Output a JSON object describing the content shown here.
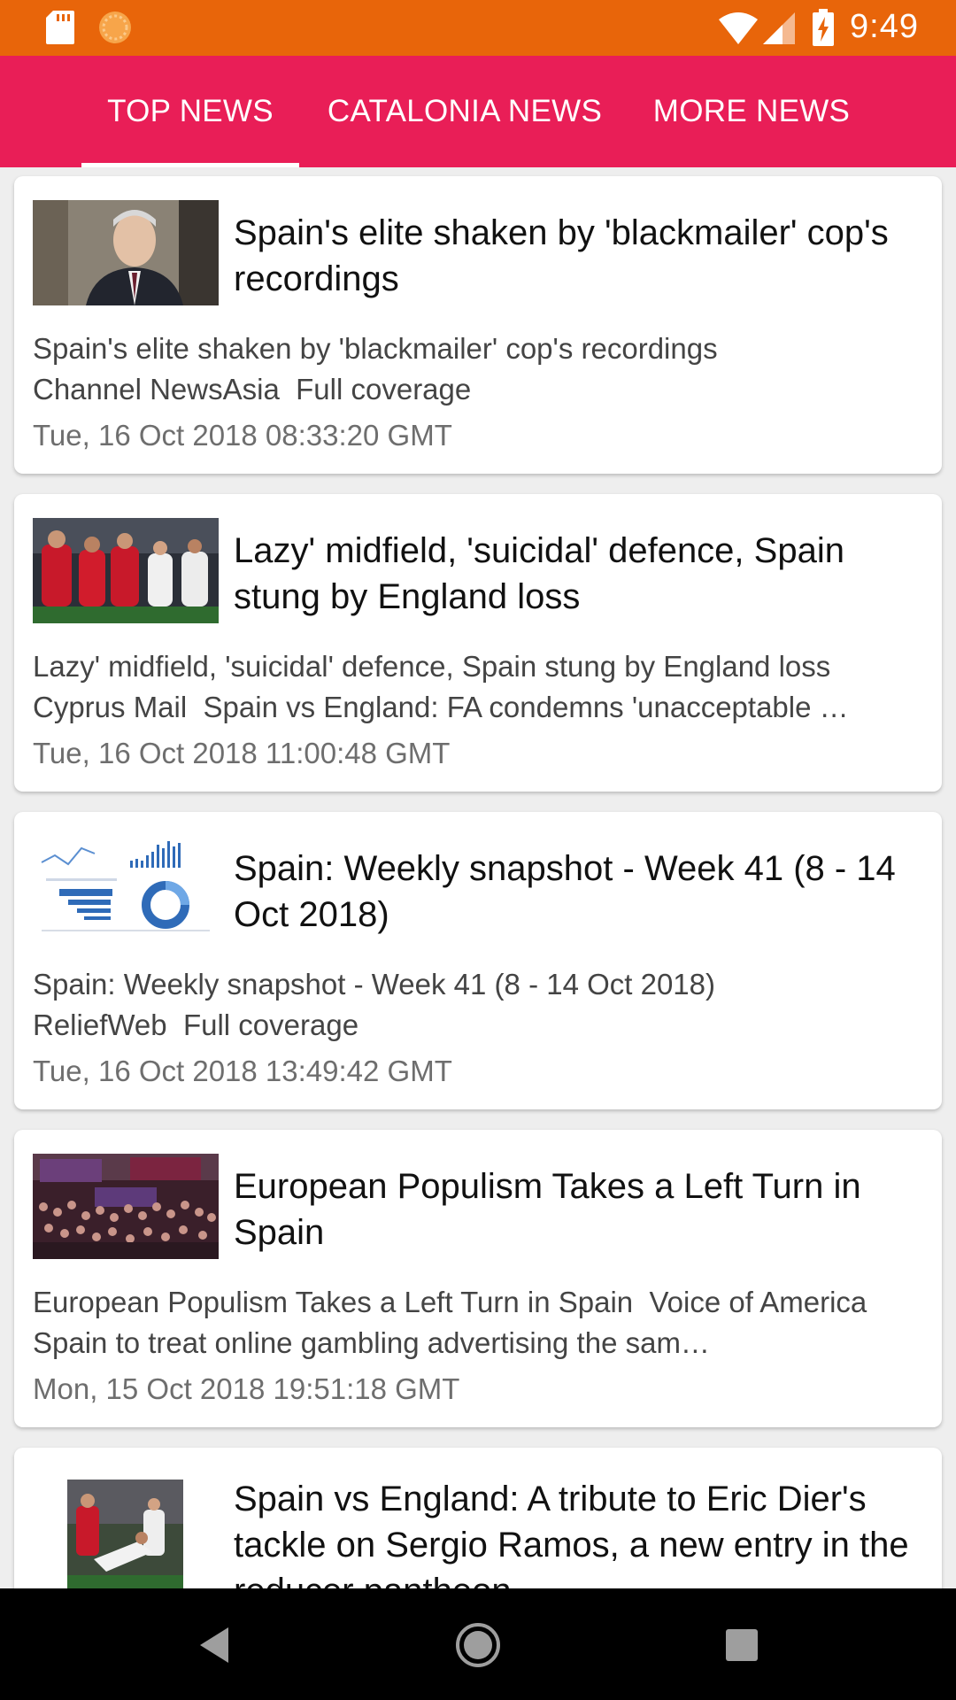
{
  "status_bar": {
    "time": "9:49",
    "icons": [
      "sd-card-icon",
      "app-notification-icon",
      "wifi-icon",
      "cell-signal-icon",
      "battery-icon"
    ],
    "background": "#e8650a"
  },
  "tabs": [
    {
      "label": "TOP NEWS",
      "selected": true
    },
    {
      "label": "CATALONIA NEWS",
      "selected": false
    },
    {
      "label": "MORE NEWS",
      "selected": false
    }
  ],
  "tab_bar_color": "#e91e57",
  "articles": [
    {
      "headline": "Spain's elite shaken by 'blackmailer' cop's recordings",
      "summary": "Spain's elite shaken by 'blackmailer' cop's recordings\nChannel NewsAsia  Full coverage",
      "date": "Tue, 16 Oct 2018 08:33:20 GMT",
      "thumbnail": "photo of man in suit at podium"
    },
    {
      "headline": "Lazy' midfield, 'suicidal' defence, Spain stung by England loss",
      "summary": "Lazy' midfield, 'suicidal' defence, Spain stung by England loss\nCyprus Mail  Spain vs England: FA condemns 'unacceptable …",
      "date": "Tue, 16 Oct 2018 11:00:48 GMT",
      "thumbnail": "football players in red jerseys"
    },
    {
      "headline": "Spain: Weekly snapshot - Week 41 (8 - 14 Oct 2018)",
      "summary": "Spain: Weekly snapshot - Week 41 (8 - 14 Oct 2018)\nReliefWeb  Full coverage",
      "date": "Tue, 16 Oct 2018 13:49:42 GMT",
      "thumbnail": "infographic with charts"
    },
    {
      "headline": "European Populism Takes a Left Turn in Spain",
      "summary": "European Populism Takes a Left Turn in Spain  Voice of America  Spain to treat online gambling advertising the sam…",
      "date": "Mon, 15 Oct 2018 19:51:18 GMT",
      "thumbnail": "crowd at political rally"
    },
    {
      "headline": "Spain vs England: A tribute to Eric Dier's tackle on Sergio Ramos, a new entry in the reducer pantheon",
      "summary": "",
      "date": "",
      "thumbnail": "football tackle photo"
    }
  ],
  "nav_bar": {
    "icons": [
      "back-icon",
      "home-icon",
      "recents-icon"
    ]
  }
}
